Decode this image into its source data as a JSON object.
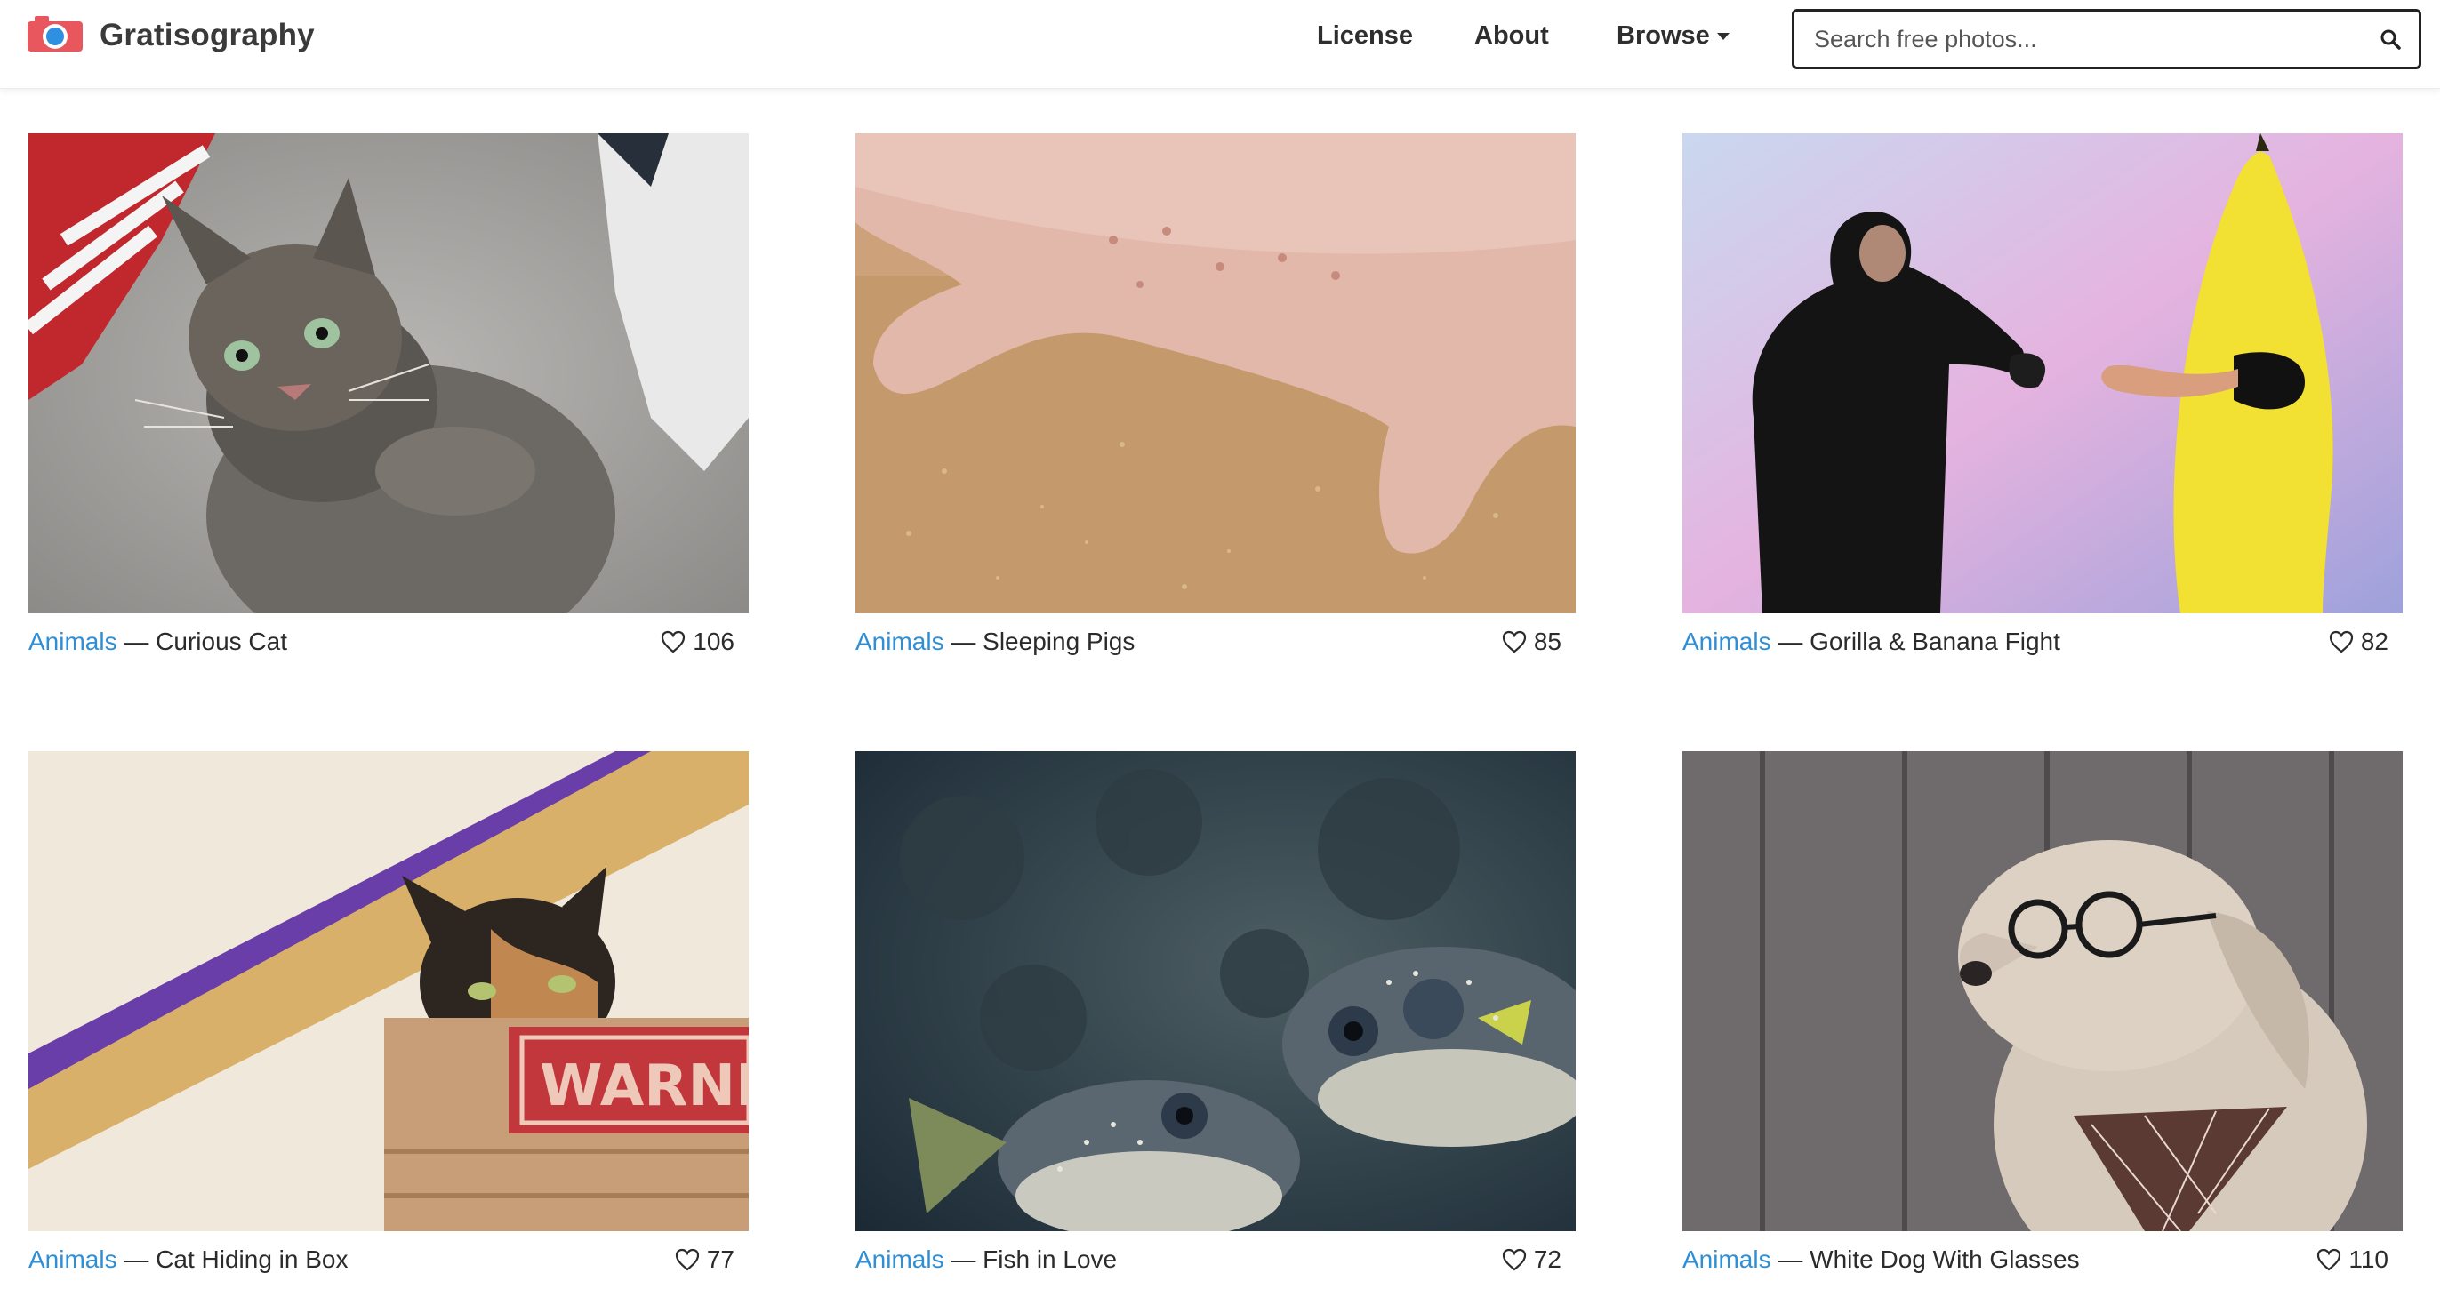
{
  "header": {
    "brand": "Gratisography",
    "nav": {
      "license": "License",
      "about": "About",
      "browse": "Browse"
    },
    "search": {
      "placeholder": "Search free photos...",
      "value": ""
    },
    "icons": {
      "logo": "camera-logo-icon",
      "search": "search-icon",
      "browse": "chevron-down-icon"
    }
  },
  "colors": {
    "link": "#2e8fd6",
    "text": "#2b2b2b",
    "logo_red": "#e8575d",
    "logo_blue": "#2f8fe0"
  },
  "gallery": {
    "separator": "—",
    "items": [
      {
        "category": "Animals",
        "title": "Curious Cat",
        "likes": "106",
        "icon": "heart-icon"
      },
      {
        "category": "Animals",
        "title": "Sleeping Pigs",
        "likes": "85",
        "icon": "heart-icon"
      },
      {
        "category": "Animals",
        "title": "Gorilla & Banana Fight",
        "likes": "82",
        "icon": "heart-icon"
      },
      {
        "category": "Animals",
        "title": "Cat Hiding in Box",
        "likes": "77",
        "icon": "heart-icon",
        "photo_sign_text": "WARNING"
      },
      {
        "category": "Animals",
        "title": "Fish in Love",
        "likes": "72",
        "icon": "heart-icon"
      },
      {
        "category": "Animals",
        "title": "White Dog With Glasses",
        "likes": "110",
        "icon": "heart-icon"
      }
    ]
  }
}
